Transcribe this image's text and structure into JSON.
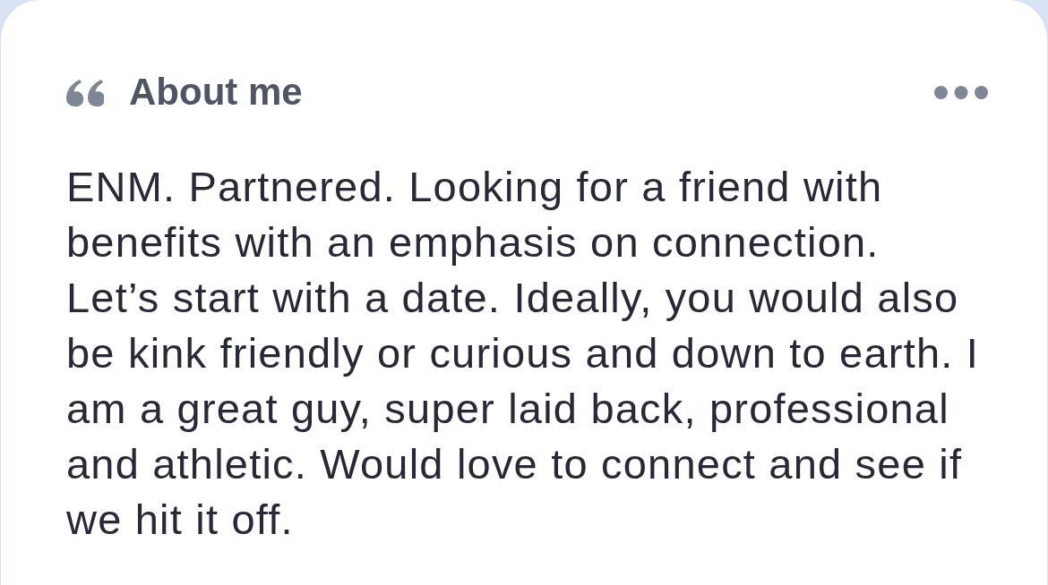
{
  "card": {
    "title": "About me",
    "body": "ENM. Partnered. Looking for a friend with benefits with an emphasis on connection. Let’s start with a date. Ideally, you would also be kink friendly or curious and down to earth. I am a great guy, super laid back, professional and athletic. Would love to connect and see if we hit it off."
  }
}
